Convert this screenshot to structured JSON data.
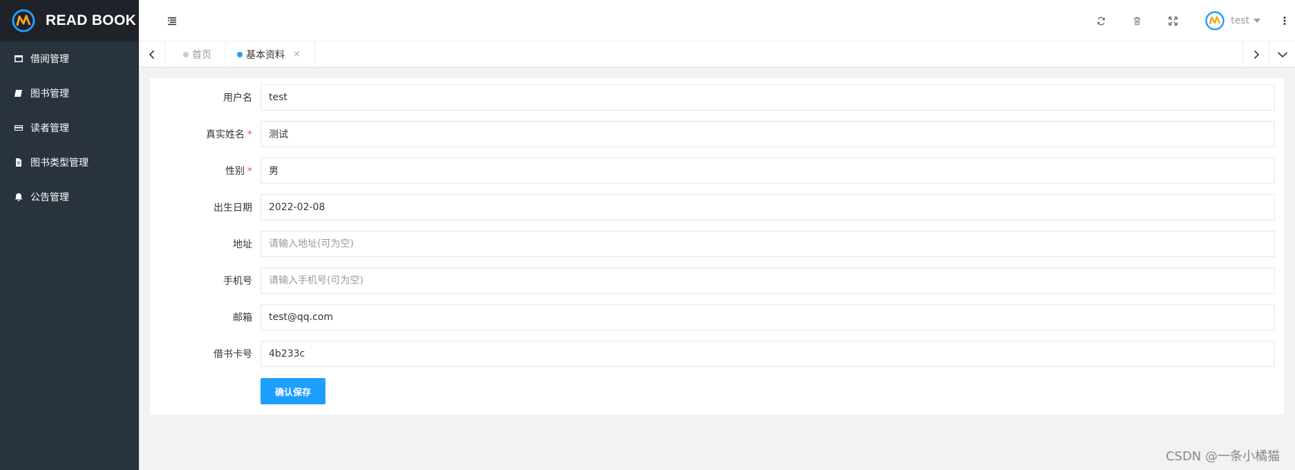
{
  "brand": {
    "title": "READ BOOK",
    "accent": "#1e9fff"
  },
  "sidebar": {
    "items": [
      {
        "label": "借阅管理",
        "icon": "window-icon"
      },
      {
        "label": "图书管理",
        "icon": "book-icon"
      },
      {
        "label": "读者管理",
        "icon": "credit-card-icon"
      },
      {
        "label": "图书类型管理",
        "icon": "file-icon"
      },
      {
        "label": "公告管理",
        "icon": "bell-icon"
      }
    ]
  },
  "header": {
    "user_name": "test",
    "icons": [
      "refresh-icon",
      "trash-icon",
      "fullscreen-icon",
      "more-icon"
    ]
  },
  "tabs": {
    "items": [
      {
        "label": "首页",
        "active": false
      },
      {
        "label": "基本资料",
        "active": true,
        "close": "×"
      }
    ]
  },
  "form": {
    "username": {
      "label": "用户名",
      "value": "test",
      "required": false
    },
    "realname": {
      "label": "真实姓名",
      "value": "测试",
      "required": true
    },
    "gender": {
      "label": "性别",
      "value": "男",
      "required": true
    },
    "birthday": {
      "label": "出生日期",
      "value": "2022-02-08",
      "required": false
    },
    "address": {
      "label": "地址",
      "value": "",
      "placeholder": "请输入地址(可为空)",
      "required": false
    },
    "phone": {
      "label": "手机号",
      "value": "",
      "placeholder": "请输入手机号(可为空)",
      "required": false
    },
    "email": {
      "label": "邮箱",
      "value": "test@qq.com",
      "required": false
    },
    "card_no": {
      "label": "借书卡号",
      "value": "4b233c",
      "required": false
    },
    "required_mark": "*",
    "submit_label": "确认保存"
  },
  "watermark": "CSDN @一条小橘猫"
}
